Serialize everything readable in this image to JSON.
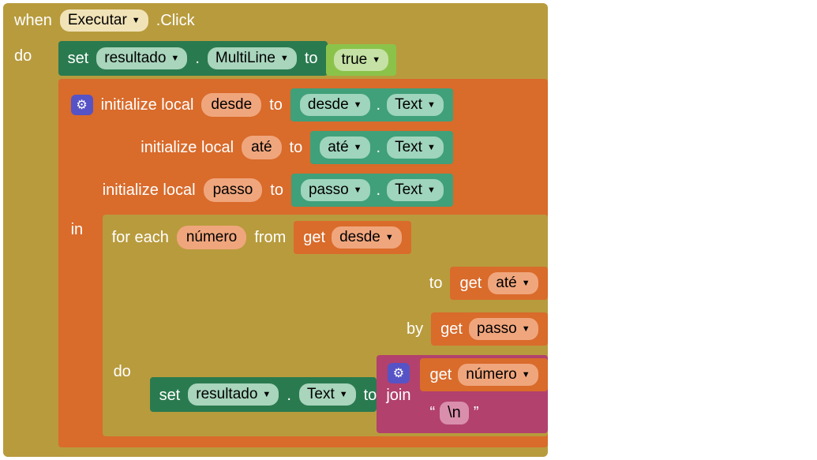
{
  "event": {
    "when": "when",
    "component": "Executar",
    "eventName": ".Click",
    "do": "do"
  },
  "setMultiline": {
    "set": "set",
    "component": "resultado",
    "property": "MultiLine",
    "to": "to",
    "value": "true"
  },
  "init": {
    "gear": "⚙",
    "label": "initialize local",
    "to": "to",
    "in": "in",
    "vars": [
      {
        "name": "desde",
        "src_component": "desde",
        "src_prop": "Text"
      },
      {
        "name": "até",
        "src_component": "até",
        "src_prop": "Text"
      },
      {
        "name": "passo",
        "src_component": "passo",
        "src_prop": "Text"
      }
    ]
  },
  "foreach": {
    "forEach": "for each",
    "var": "número",
    "from": "from",
    "to": "to",
    "by": "by",
    "do": "do",
    "fromVar": "desde",
    "toVar": "até",
    "byVar": "passo",
    "get": "get"
  },
  "setText": {
    "set": "set",
    "component": "resultado",
    "property": "Text",
    "to": "to"
  },
  "join": {
    "gear": "⚙",
    "join": "join",
    "get": "get",
    "getVar": "número",
    "lq": "“",
    "rq": "”",
    "literal": "\\n"
  },
  "dot": "."
}
